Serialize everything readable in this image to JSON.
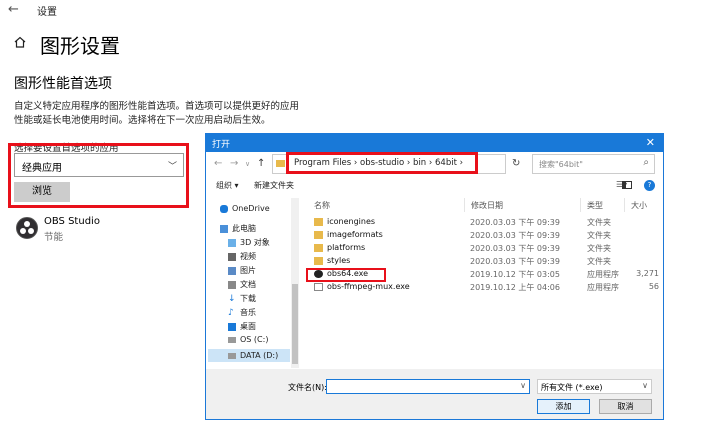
{
  "settings": {
    "window_title": "设置",
    "page_title": "图形设置",
    "section_title": "图形性能首选项",
    "description": "自定义特定应用程序的图形性能首选项。首选项可以提供更好的应用性能或延长电池使用时间。选择将在下一次应用启动后生效。",
    "choose_label": "选择要设置首选项的应用",
    "app_type_value": "经典应用",
    "browse_label": "浏览",
    "app": {
      "name": "OBS Studio",
      "mode": "节能"
    }
  },
  "dialog": {
    "title": "打开",
    "breadcrumb": [
      "Program Files",
      "obs-studio",
      "bin",
      "64bit"
    ],
    "search_placeholder": "搜索\"64bit\"",
    "organize_label": "组织 ▾",
    "new_folder_label": "新建文件夹",
    "sidebar": [
      "OneDrive",
      "此电脑",
      "3D 对象",
      "视频",
      "图片",
      "文档",
      "下载",
      "音乐",
      "桌面",
      "OS (C:)",
      "DATA (D:)"
    ],
    "columns": {
      "name": "名称",
      "date": "修改日期",
      "type": "类型",
      "size": "大小"
    },
    "files": [
      {
        "name": "iconengines",
        "date": "2020.03.03 下午 09:39",
        "type": "文件夹",
        "size": ""
      },
      {
        "name": "imageformats",
        "date": "2020.03.03 下午 09:39",
        "type": "文件夹",
        "size": ""
      },
      {
        "name": "platforms",
        "date": "2020.03.03 下午 09:39",
        "type": "文件夹",
        "size": ""
      },
      {
        "name": "styles",
        "date": "2020.03.03 下午 09:39",
        "type": "文件夹",
        "size": ""
      },
      {
        "name": "obs64.exe",
        "date": "2019.10.12 下午 03:05",
        "type": "应用程序",
        "size": "3,271"
      },
      {
        "name": "obs-ffmpeg-mux.exe",
        "date": "2019.10.12 上午 04:06",
        "type": "应用程序",
        "size": "56"
      }
    ],
    "filename_label": "文件名(N):",
    "filename_value": "",
    "filetype_value": "所有文件 (*.exe)",
    "ok_label": "添加",
    "cancel_label": "取消"
  },
  "colors": {
    "accent": "#1979d8",
    "highlight": "#e8101a",
    "folder": "#e8b94b"
  }
}
